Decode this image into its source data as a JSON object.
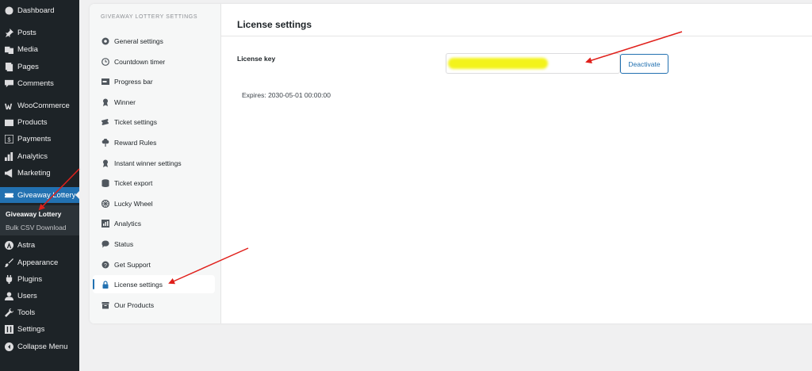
{
  "wp_menu": {
    "items": [
      {
        "label": "Dashboard",
        "icon": "dashboard-icon"
      },
      {
        "label": "Posts",
        "icon": "pin-icon"
      },
      {
        "label": "Media",
        "icon": "media-icon"
      },
      {
        "label": "Pages",
        "icon": "pages-icon"
      },
      {
        "label": "Comments",
        "icon": "comments-icon"
      },
      {
        "label": "WooCommerce",
        "icon": "woocommerce-icon"
      },
      {
        "label": "Products",
        "icon": "products-icon"
      },
      {
        "label": "Payments",
        "icon": "payments-icon"
      },
      {
        "label": "Analytics",
        "icon": "analytics-icon"
      },
      {
        "label": "Marketing",
        "icon": "megaphone-icon"
      },
      {
        "label": "Giveaway Lottery",
        "icon": "ticket-icon"
      },
      {
        "label": "Astra",
        "icon": "astra-icon"
      },
      {
        "label": "Appearance",
        "icon": "brush-icon"
      },
      {
        "label": "Plugins",
        "icon": "plugin-icon"
      },
      {
        "label": "Users",
        "icon": "user-icon"
      },
      {
        "label": "Tools",
        "icon": "wrench-icon"
      },
      {
        "label": "Settings",
        "icon": "settings-icon"
      },
      {
        "label": "Collapse Menu",
        "icon": "collapse-icon"
      }
    ],
    "submenu": [
      "Giveaway Lottery",
      "Bulk CSV Download"
    ]
  },
  "plugin_nav": {
    "heading": "GIVEAWAY LOTTERY SETTINGS",
    "items": [
      {
        "label": "General settings",
        "icon": "gear-icon"
      },
      {
        "label": "Countdown timer",
        "icon": "clock-icon"
      },
      {
        "label": "Progress bar",
        "icon": "progress-bar-icon"
      },
      {
        "label": "Winner",
        "icon": "award-icon"
      },
      {
        "label": "Ticket settings",
        "icon": "tickets-icon"
      },
      {
        "label": "Reward Rules",
        "icon": "reward-icon"
      },
      {
        "label": "Instant winner settings",
        "icon": "award-icon"
      },
      {
        "label": "Ticket export",
        "icon": "database-icon"
      },
      {
        "label": "Lucky Wheel",
        "icon": "wheel-icon"
      },
      {
        "label": "Analytics",
        "icon": "chart-icon"
      },
      {
        "label": "Status",
        "icon": "chat-icon"
      },
      {
        "label": "Get Support",
        "icon": "help-icon"
      },
      {
        "label": "License settings",
        "icon": "lock-icon"
      },
      {
        "label": "Our Products",
        "icon": "box-icon"
      }
    ]
  },
  "main": {
    "title": "License settings",
    "license_key_label": "License key",
    "deactivate_label": "Deactivate",
    "expires_text": "Expires: 2030-05-01 00:00:00"
  },
  "colors": {
    "wp_sidebar": "#1d2327",
    "accent": "#2271b1",
    "highlight": "#f3f31b",
    "arrow": "#e0201b"
  }
}
